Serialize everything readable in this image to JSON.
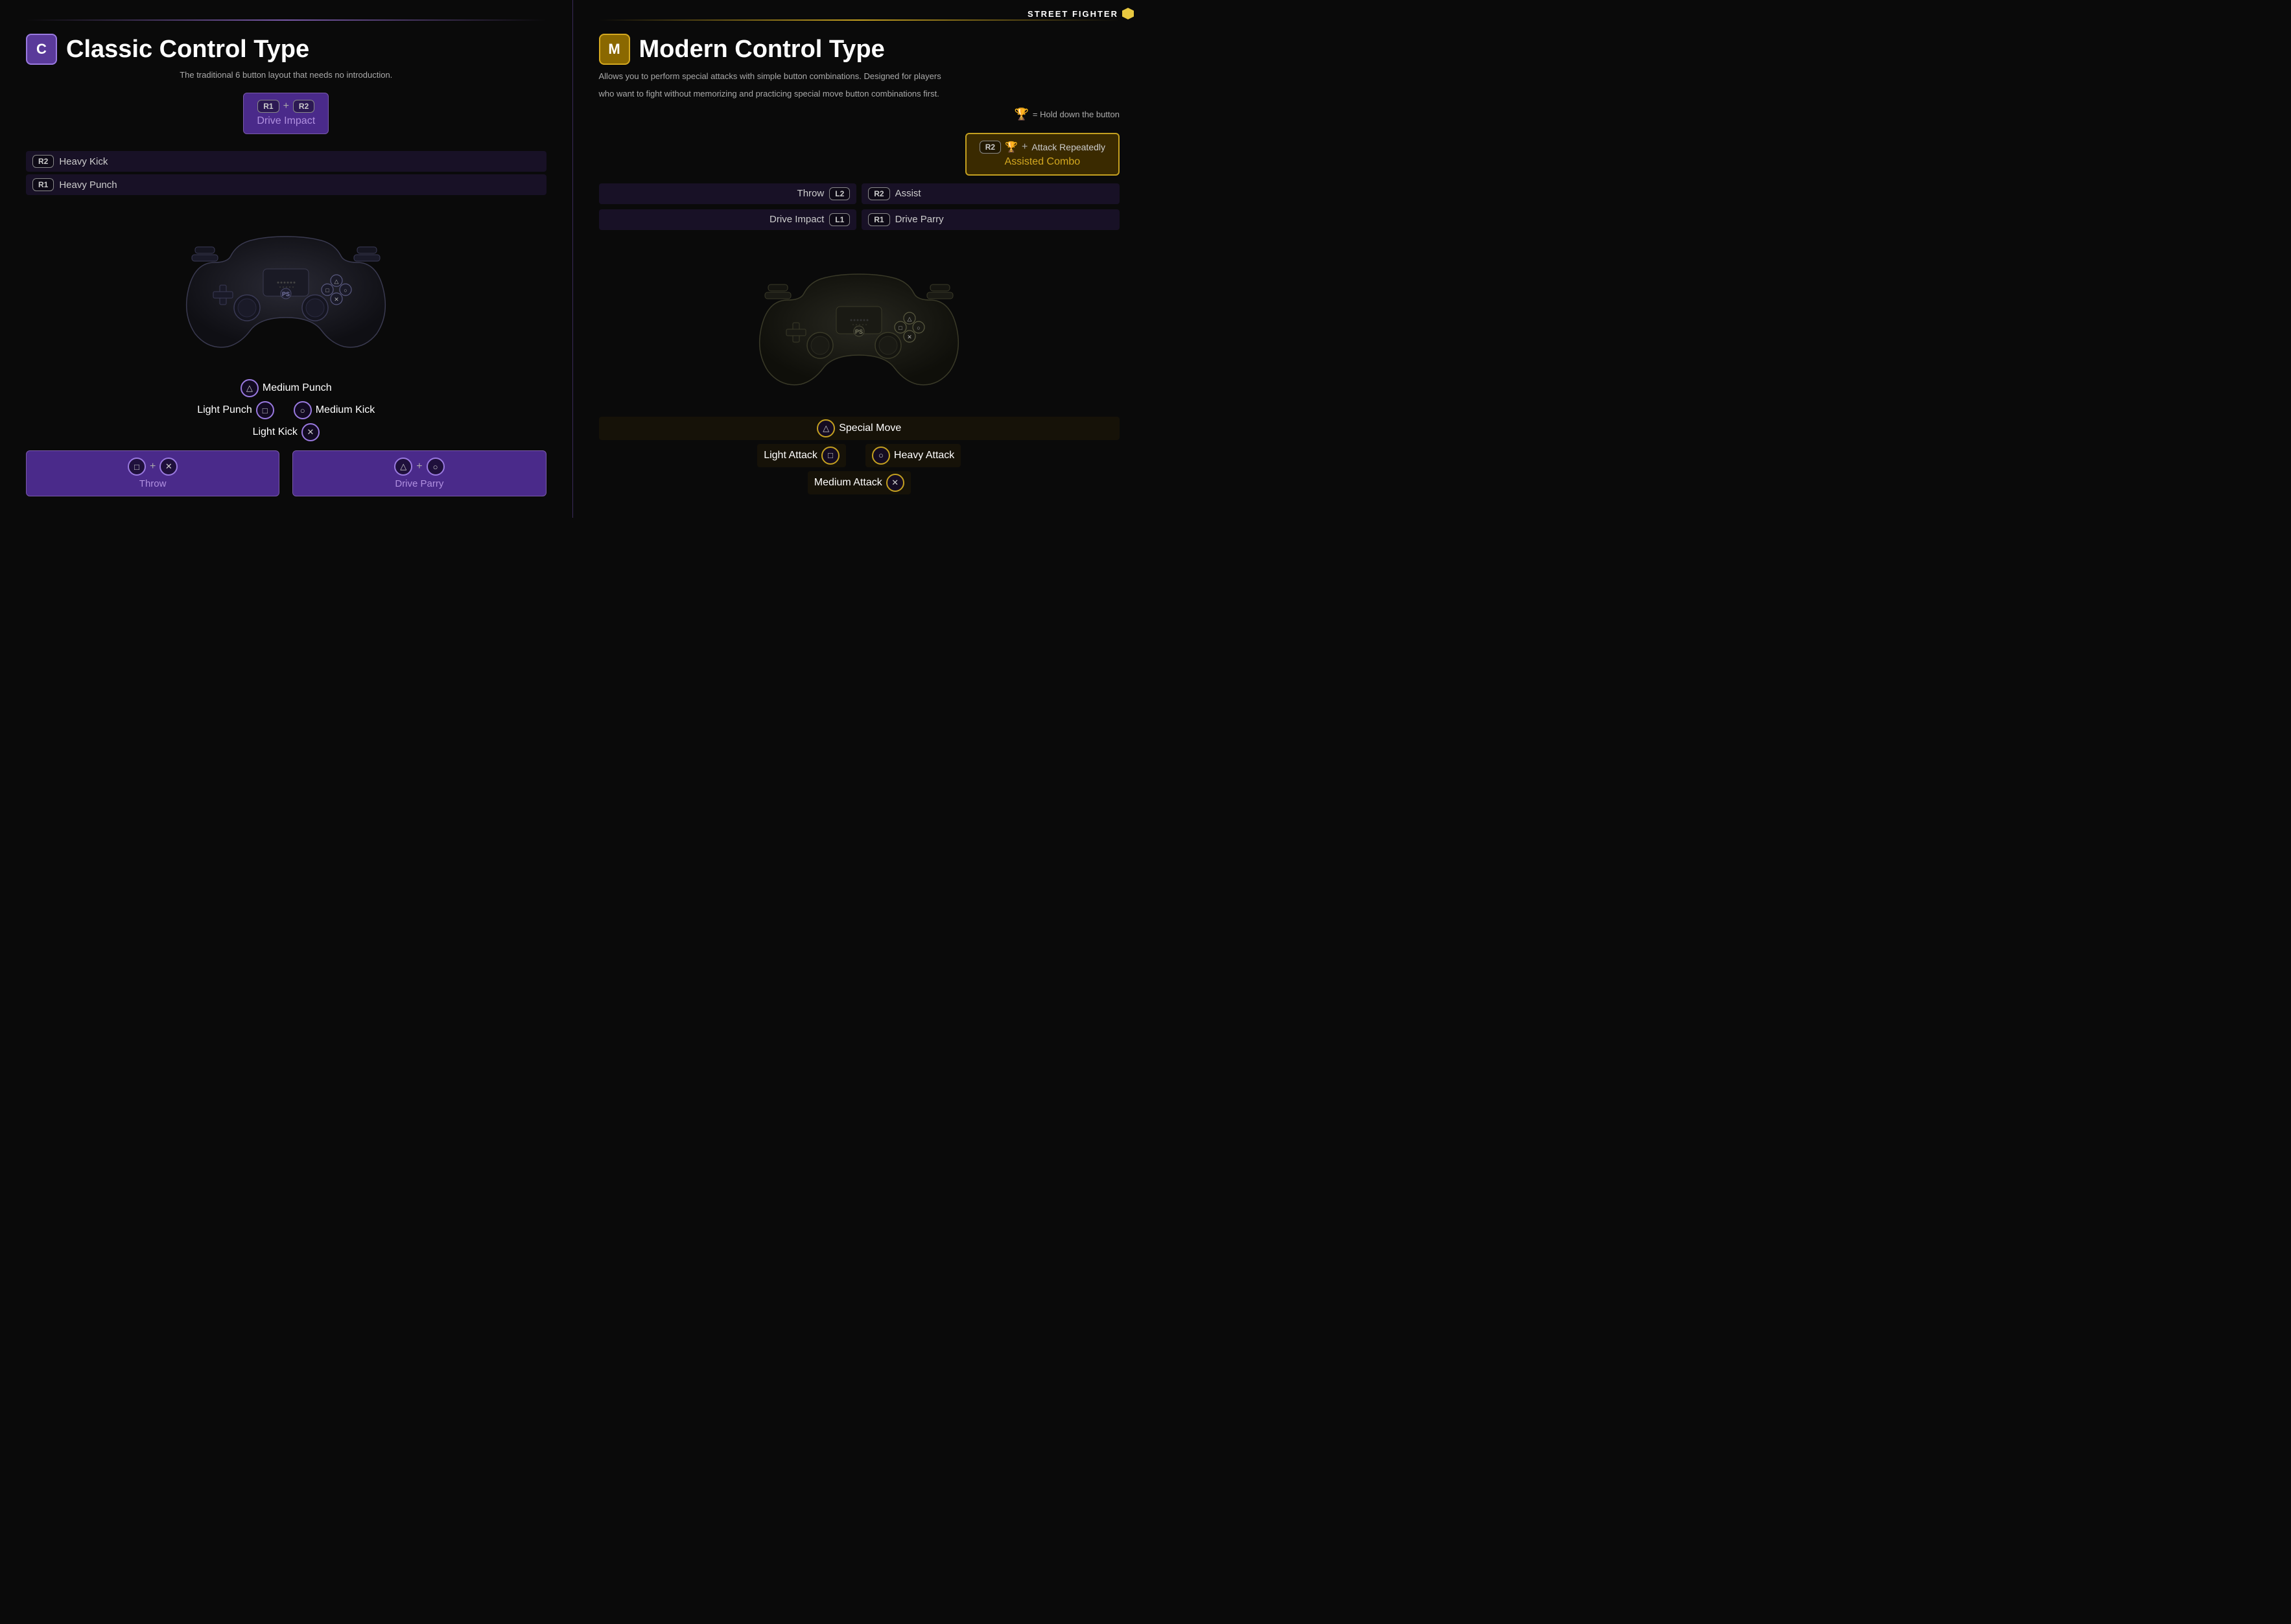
{
  "logo": {
    "text": "STREET FIGHTER",
    "icon_label": "SF logo"
  },
  "classic": {
    "badge_letter": "C",
    "title": "Classic Control Type",
    "subtitle": "The traditional 6 button layout that needs no introduction.",
    "drive_impact": {
      "keys": [
        "R1",
        "+",
        "R2"
      ],
      "label": "Drive Impact"
    },
    "buttons": [
      {
        "badge": "R2",
        "label": "Heavy Kick"
      },
      {
        "badge": "R1",
        "label": "Heavy Punch"
      }
    ],
    "bottom_center": [
      {
        "icon": "△",
        "label": "Medium Punch"
      }
    ],
    "bottom_rows": [
      [
        {
          "text": "Light Punch",
          "icon": "□",
          "side": "left"
        },
        {
          "icon": "○",
          "text": "Medium Kick",
          "side": "right"
        }
      ],
      [
        {
          "text": "Light Kick",
          "icon": "✕",
          "side": "left"
        }
      ]
    ],
    "combos": [
      {
        "keys": [
          "□",
          "+",
          "✕"
        ],
        "label": "Throw"
      },
      {
        "keys": [
          "△",
          "+",
          "○"
        ],
        "label": "Drive Parry"
      }
    ]
  },
  "modern": {
    "badge_letter": "M",
    "title": "Modern Control Type",
    "subtitle_line1": "Allows you to perform special attacks with simple button combinations. Designed for players",
    "subtitle_line2": "who want to fight without memorizing and practicing special move button combinations first.",
    "hold_note": "= Hold down the button",
    "assisted_combo": {
      "keys": [
        "R2",
        "🏆",
        "+",
        "Attack Repeatedly"
      ],
      "label": "Assisted Combo"
    },
    "left_buttons": [
      {
        "label": "Throw",
        "badge": "L2"
      },
      {
        "label": "Drive Impact",
        "badge": "L1"
      }
    ],
    "right_buttons": [
      {
        "badge": "R2",
        "label": "Assist"
      },
      {
        "badge": "R1",
        "label": "Drive Parry"
      }
    ],
    "bottom_center": [
      {
        "icon": "△",
        "label": "Special Move"
      }
    ],
    "bottom_rows": [
      [
        {
          "text": "Light Attack",
          "icon": "□",
          "side": "left"
        },
        {
          "icon": "○",
          "text": "Heavy Attack",
          "side": "right"
        }
      ],
      [
        {
          "text": "Medium Attack",
          "icon": "✕",
          "side": "left"
        }
      ]
    ]
  }
}
